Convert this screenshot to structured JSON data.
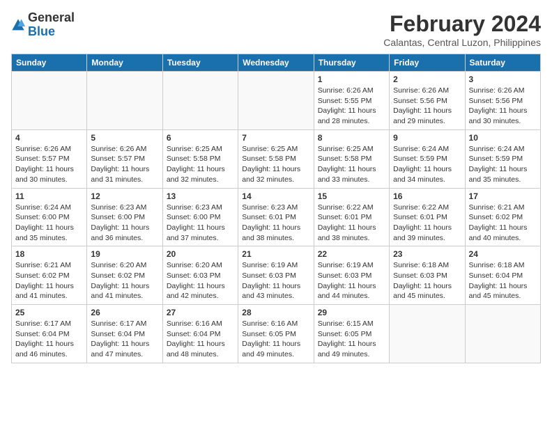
{
  "logo": {
    "general": "General",
    "blue": "Blue"
  },
  "title": "February 2024",
  "location": "Calantas, Central Luzon, Philippines",
  "days_of_week": [
    "Sunday",
    "Monday",
    "Tuesday",
    "Wednesday",
    "Thursday",
    "Friday",
    "Saturday"
  ],
  "weeks": [
    [
      {
        "day": "",
        "info": ""
      },
      {
        "day": "",
        "info": ""
      },
      {
        "day": "",
        "info": ""
      },
      {
        "day": "",
        "info": ""
      },
      {
        "day": "1",
        "info": "Sunrise: 6:26 AM\nSunset: 5:55 PM\nDaylight: 11 hours and 28 minutes."
      },
      {
        "day": "2",
        "info": "Sunrise: 6:26 AM\nSunset: 5:56 PM\nDaylight: 11 hours and 29 minutes."
      },
      {
        "day": "3",
        "info": "Sunrise: 6:26 AM\nSunset: 5:56 PM\nDaylight: 11 hours and 30 minutes."
      }
    ],
    [
      {
        "day": "4",
        "info": "Sunrise: 6:26 AM\nSunset: 5:57 PM\nDaylight: 11 hours and 30 minutes."
      },
      {
        "day": "5",
        "info": "Sunrise: 6:26 AM\nSunset: 5:57 PM\nDaylight: 11 hours and 31 minutes."
      },
      {
        "day": "6",
        "info": "Sunrise: 6:25 AM\nSunset: 5:58 PM\nDaylight: 11 hours and 32 minutes."
      },
      {
        "day": "7",
        "info": "Sunrise: 6:25 AM\nSunset: 5:58 PM\nDaylight: 11 hours and 32 minutes."
      },
      {
        "day": "8",
        "info": "Sunrise: 6:25 AM\nSunset: 5:58 PM\nDaylight: 11 hours and 33 minutes."
      },
      {
        "day": "9",
        "info": "Sunrise: 6:24 AM\nSunset: 5:59 PM\nDaylight: 11 hours and 34 minutes."
      },
      {
        "day": "10",
        "info": "Sunrise: 6:24 AM\nSunset: 5:59 PM\nDaylight: 11 hours and 35 minutes."
      }
    ],
    [
      {
        "day": "11",
        "info": "Sunrise: 6:24 AM\nSunset: 6:00 PM\nDaylight: 11 hours and 35 minutes."
      },
      {
        "day": "12",
        "info": "Sunrise: 6:23 AM\nSunset: 6:00 PM\nDaylight: 11 hours and 36 minutes."
      },
      {
        "day": "13",
        "info": "Sunrise: 6:23 AM\nSunset: 6:00 PM\nDaylight: 11 hours and 37 minutes."
      },
      {
        "day": "14",
        "info": "Sunrise: 6:23 AM\nSunset: 6:01 PM\nDaylight: 11 hours and 38 minutes."
      },
      {
        "day": "15",
        "info": "Sunrise: 6:22 AM\nSunset: 6:01 PM\nDaylight: 11 hours and 38 minutes."
      },
      {
        "day": "16",
        "info": "Sunrise: 6:22 AM\nSunset: 6:01 PM\nDaylight: 11 hours and 39 minutes."
      },
      {
        "day": "17",
        "info": "Sunrise: 6:21 AM\nSunset: 6:02 PM\nDaylight: 11 hours and 40 minutes."
      }
    ],
    [
      {
        "day": "18",
        "info": "Sunrise: 6:21 AM\nSunset: 6:02 PM\nDaylight: 11 hours and 41 minutes."
      },
      {
        "day": "19",
        "info": "Sunrise: 6:20 AM\nSunset: 6:02 PM\nDaylight: 11 hours and 41 minutes."
      },
      {
        "day": "20",
        "info": "Sunrise: 6:20 AM\nSunset: 6:03 PM\nDaylight: 11 hours and 42 minutes."
      },
      {
        "day": "21",
        "info": "Sunrise: 6:19 AM\nSunset: 6:03 PM\nDaylight: 11 hours and 43 minutes."
      },
      {
        "day": "22",
        "info": "Sunrise: 6:19 AM\nSunset: 6:03 PM\nDaylight: 11 hours and 44 minutes."
      },
      {
        "day": "23",
        "info": "Sunrise: 6:18 AM\nSunset: 6:03 PM\nDaylight: 11 hours and 45 minutes."
      },
      {
        "day": "24",
        "info": "Sunrise: 6:18 AM\nSunset: 6:04 PM\nDaylight: 11 hours and 45 minutes."
      }
    ],
    [
      {
        "day": "25",
        "info": "Sunrise: 6:17 AM\nSunset: 6:04 PM\nDaylight: 11 hours and 46 minutes."
      },
      {
        "day": "26",
        "info": "Sunrise: 6:17 AM\nSunset: 6:04 PM\nDaylight: 11 hours and 47 minutes."
      },
      {
        "day": "27",
        "info": "Sunrise: 6:16 AM\nSunset: 6:04 PM\nDaylight: 11 hours and 48 minutes."
      },
      {
        "day": "28",
        "info": "Sunrise: 6:16 AM\nSunset: 6:05 PM\nDaylight: 11 hours and 49 minutes."
      },
      {
        "day": "29",
        "info": "Sunrise: 6:15 AM\nSunset: 6:05 PM\nDaylight: 11 hours and 49 minutes."
      },
      {
        "day": "",
        "info": ""
      },
      {
        "day": "",
        "info": ""
      }
    ]
  ]
}
